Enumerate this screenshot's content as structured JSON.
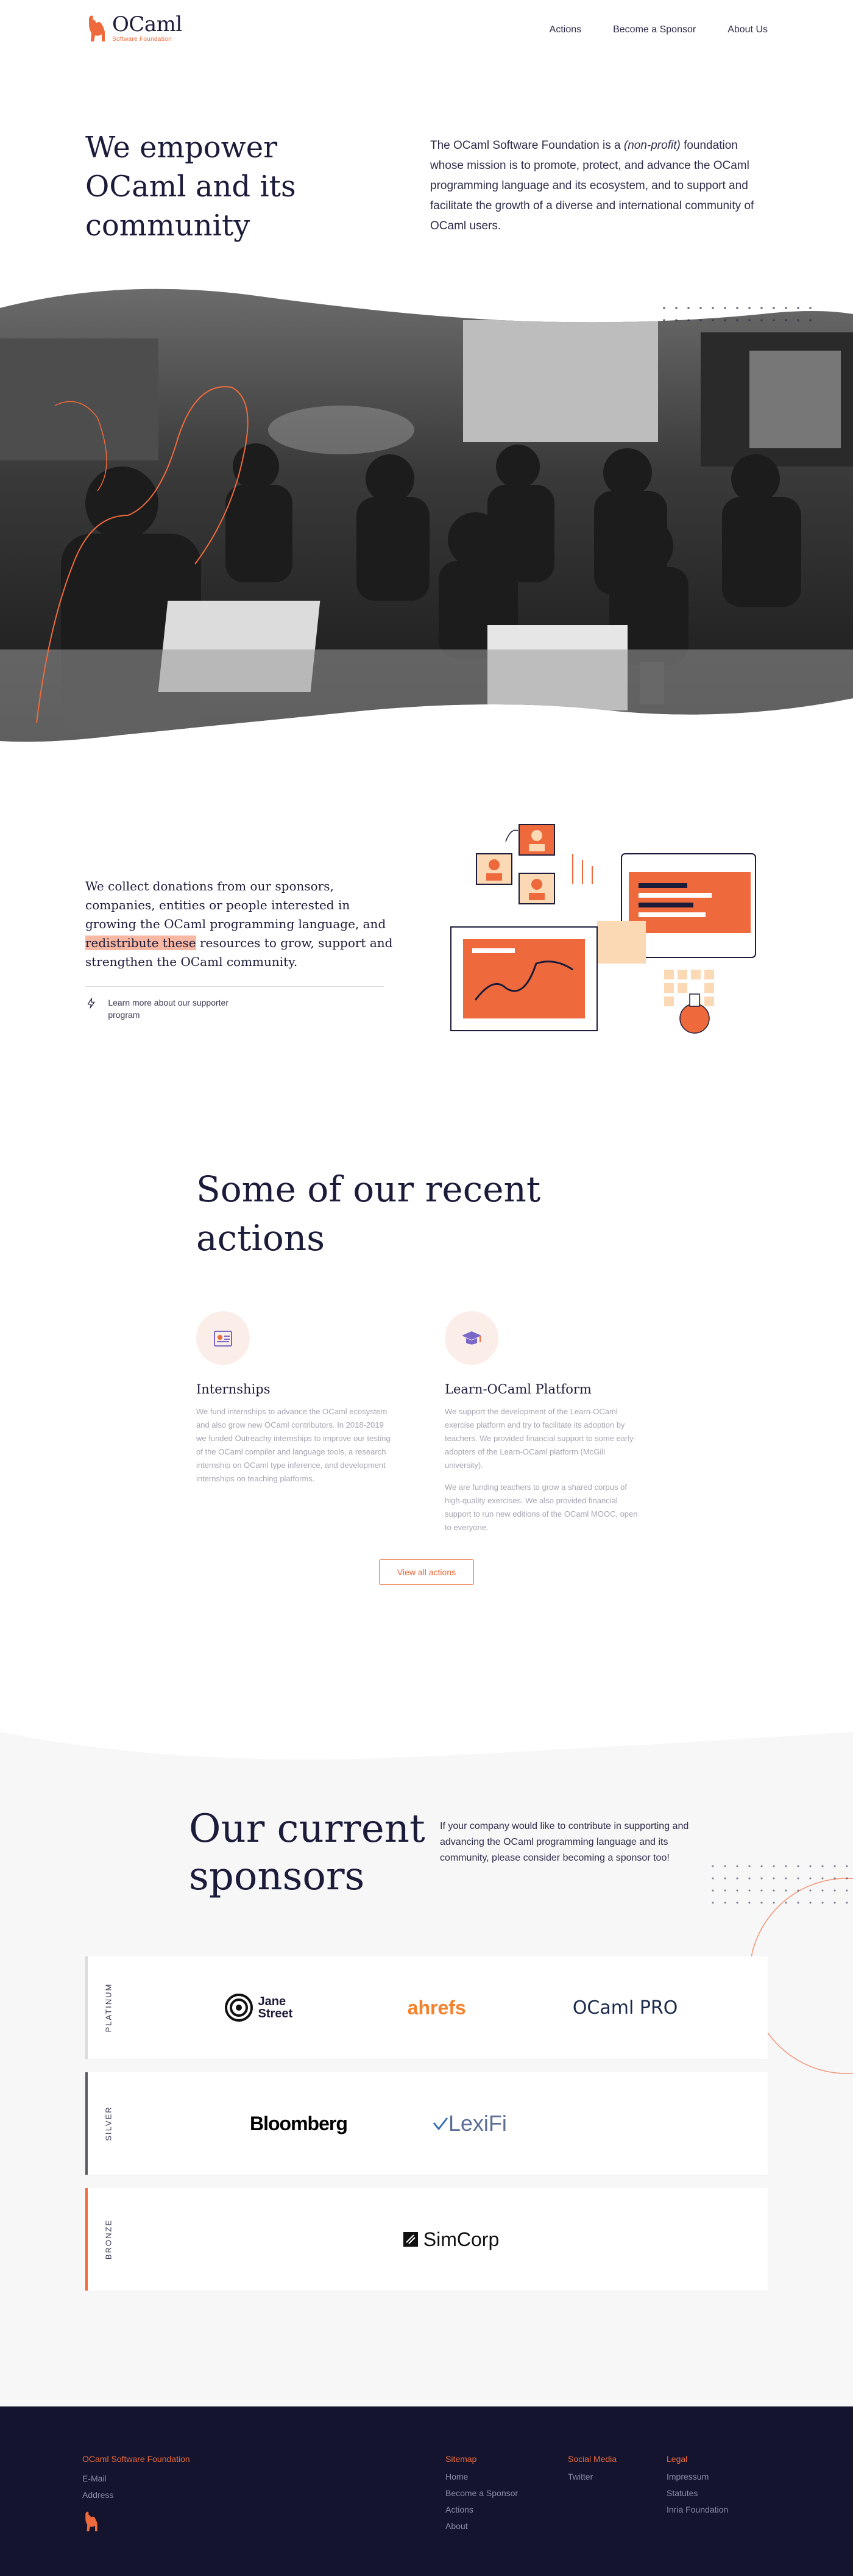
{
  "header": {
    "logo_name": "OCaml",
    "logo_sub": "Software Foundation",
    "nav": [
      "Actions",
      "Become a Sponsor",
      "About Us"
    ]
  },
  "hero": {
    "title": "We empower OCaml and its community",
    "desc_before": "The OCaml Software Foundation is a ",
    "desc_em": "(non-profit)",
    "desc_after": " foundation whose mission is to promote, protect, and advance the OCaml programming language and its ecosystem, and to support and facilitate the growth of a diverse and international community of OCaml users."
  },
  "donations": {
    "text_before": "We collect donations from our sponsors, companies, entities or people interested in growing the OCaml programming language, and ",
    "text_highlight": "redistribute these",
    "text_after": " resources to grow, support and strengthen the OCaml community.",
    "learn_more": "Learn more about our supporter program"
  },
  "actions": {
    "title": "Some of our recent actions",
    "cards": [
      {
        "title": "Internships",
        "paragraphs": [
          "We fund internships to advance the OCaml ecosystem and also grow new OCaml contributors. In 2018-2019 we funded Outreachy internships to improve our testing of the OCaml compiler and language tools, a research internship on OCaml type inference, and development internships on teaching platforms."
        ]
      },
      {
        "title": "Learn-OCaml Platform",
        "paragraphs": [
          "We support the development of the Learn-OCaml exercise platform and try to facilitate its adoption by teachers. We provided financial support to some early-adopters of the Learn-OCaml platform (McGill university).",
          "We are funding teachers to grow a shared corpus of high-quality exercises. We also provided financial support to run new editions of the OCaml MOOC, open to everyone."
        ]
      }
    ],
    "view_all": "View all actions"
  },
  "sponsors": {
    "title": "Our current sponsors",
    "desc": "If your company would like to contribute in supporting and advancing the OCaml programming language and its community, please consider becoming a sponsor too!",
    "tiers": [
      {
        "name": "PLATINUM",
        "color": "#d9d9df",
        "logos": [
          "Jane Street",
          "ahrefs",
          "OCaml PRO"
        ]
      },
      {
        "name": "SILVER",
        "color": "#5a5a66",
        "logos": [
          "Bloomberg",
          "LexiFi"
        ]
      },
      {
        "name": "BRONZE",
        "color": "#ee6a3c",
        "logos": [
          "SimCorp"
        ]
      }
    ]
  },
  "footer": {
    "org": "OCaml Software Foundation",
    "org_links": [
      "E-Mail",
      "Address"
    ],
    "columns": [
      {
        "head": "Sitemap",
        "links": [
          "Home",
          "Become a Sponsor",
          "Actions",
          "About"
        ]
      },
      {
        "head": "Social Media",
        "links": [
          "Twitter"
        ]
      },
      {
        "head": "Legal",
        "links": [
          "Impressum",
          "Statutes",
          "Inria Foundation"
        ]
      }
    ]
  },
  "colors": {
    "accent": "#ee6a3c",
    "navy": "#1b1b3a",
    "footer_bg": "#15142e",
    "highlight": "#f9b8a3"
  }
}
